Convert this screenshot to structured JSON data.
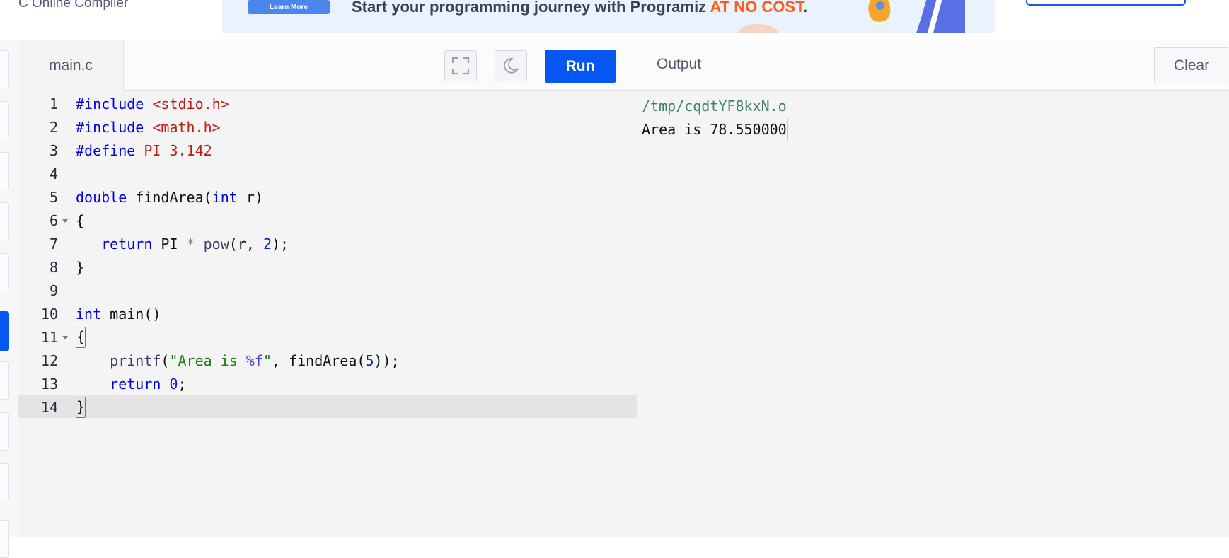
{
  "header": {
    "site_title": "C Online Compiler",
    "ad": {
      "button_label": "Learn More",
      "text_prefix": "Start your programming journey with Programiz ",
      "text_highlight": "AT NO COST",
      "text_suffix": "."
    }
  },
  "sidebar": {
    "items": [
      {
        "icon": "language-icon",
        "active": false
      },
      {
        "icon": "language-icon",
        "active": false
      },
      {
        "icon": "language-icon",
        "active": false
      },
      {
        "icon": "language-icon",
        "active": false
      },
      {
        "icon": "language-icon",
        "active": false
      },
      {
        "icon": "language-icon",
        "active": true
      },
      {
        "icon": "language-icon",
        "active": false
      },
      {
        "icon": "language-icon",
        "active": false
      },
      {
        "icon": "language-icon",
        "active": false
      }
    ]
  },
  "editor": {
    "file_tab": "main.c",
    "fullscreen_icon": "fullscreen-icon",
    "theme_icon": "moon-icon",
    "run_label": "Run",
    "active_line": 14,
    "lines": [
      {
        "num": "1",
        "fold": false,
        "tokens": [
          {
            "t": "kw",
            "v": "#include "
          },
          {
            "t": "str",
            "v": "<stdio.h>"
          }
        ]
      },
      {
        "num": "2",
        "fold": false,
        "tokens": [
          {
            "t": "kw",
            "v": "#include "
          },
          {
            "t": "str",
            "v": "<math.h>"
          }
        ]
      },
      {
        "num": "3",
        "fold": false,
        "tokens": [
          {
            "t": "kw",
            "v": "#define "
          },
          {
            "t": "str",
            "v": "PI 3.142"
          }
        ]
      },
      {
        "num": "4",
        "fold": false,
        "tokens": []
      },
      {
        "num": "5",
        "fold": false,
        "tokens": [
          {
            "t": "kw",
            "v": "double"
          },
          {
            "t": "txt",
            "v": " findArea("
          },
          {
            "t": "kw",
            "v": "int"
          },
          {
            "t": "txt",
            "v": " r)"
          }
        ]
      },
      {
        "num": "6",
        "fold": true,
        "tokens": [
          {
            "t": "txt",
            "v": "{"
          }
        ]
      },
      {
        "num": "7",
        "fold": false,
        "tokens": [
          {
            "t": "txt",
            "v": "   "
          },
          {
            "t": "kw",
            "v": "return"
          },
          {
            "t": "txt",
            "v": " PI "
          },
          {
            "t": "op",
            "v": "*"
          },
          {
            "t": "txt",
            "v": " "
          },
          {
            "t": "fn",
            "v": "pow"
          },
          {
            "t": "txt",
            "v": "(r, "
          },
          {
            "t": "num",
            "v": "2"
          },
          {
            "t": "txt",
            "v": ");"
          }
        ]
      },
      {
        "num": "8",
        "fold": false,
        "tokens": [
          {
            "t": "txt",
            "v": "}"
          }
        ]
      },
      {
        "num": "9",
        "fold": false,
        "tokens": []
      },
      {
        "num": "10",
        "fold": false,
        "tokens": [
          {
            "t": "kw",
            "v": "int"
          },
          {
            "t": "txt",
            "v": " main()"
          }
        ]
      },
      {
        "num": "11",
        "fold": true,
        "tokens": [
          {
            "t": "cur",
            "v": "{"
          }
        ]
      },
      {
        "num": "12",
        "fold": false,
        "tokens": [
          {
            "t": "txt",
            "v": "    "
          },
          {
            "t": "fn",
            "v": "printf"
          },
          {
            "t": "txt",
            "v": "("
          },
          {
            "t": "lit",
            "v": "\"Area is "
          },
          {
            "t": "fmt",
            "v": "%f"
          },
          {
            "t": "lit",
            "v": "\""
          },
          {
            "t": "txt",
            "v": ", findArea("
          },
          {
            "t": "num",
            "v": "5"
          },
          {
            "t": "txt",
            "v": "));"
          }
        ]
      },
      {
        "num": "13",
        "fold": false,
        "tokens": [
          {
            "t": "txt",
            "v": "    "
          },
          {
            "t": "kw",
            "v": "return"
          },
          {
            "t": "txt",
            "v": " "
          },
          {
            "t": "num",
            "v": "0"
          },
          {
            "t": "txt",
            "v": ";"
          }
        ]
      },
      {
        "num": "14",
        "fold": false,
        "tokens": [
          {
            "t": "cur",
            "v": "}"
          }
        ]
      }
    ]
  },
  "output": {
    "title": "Output",
    "clear_label": "Clear",
    "lines": [
      "/tmp/cqdtYF8kxN.o",
      "Area is 78.550000"
    ]
  },
  "colors": {
    "accent": "#0556f3",
    "keyword": "#0000e6",
    "string": "#c41a16",
    "literal": "#16820e",
    "output_path": "#3b8260"
  }
}
